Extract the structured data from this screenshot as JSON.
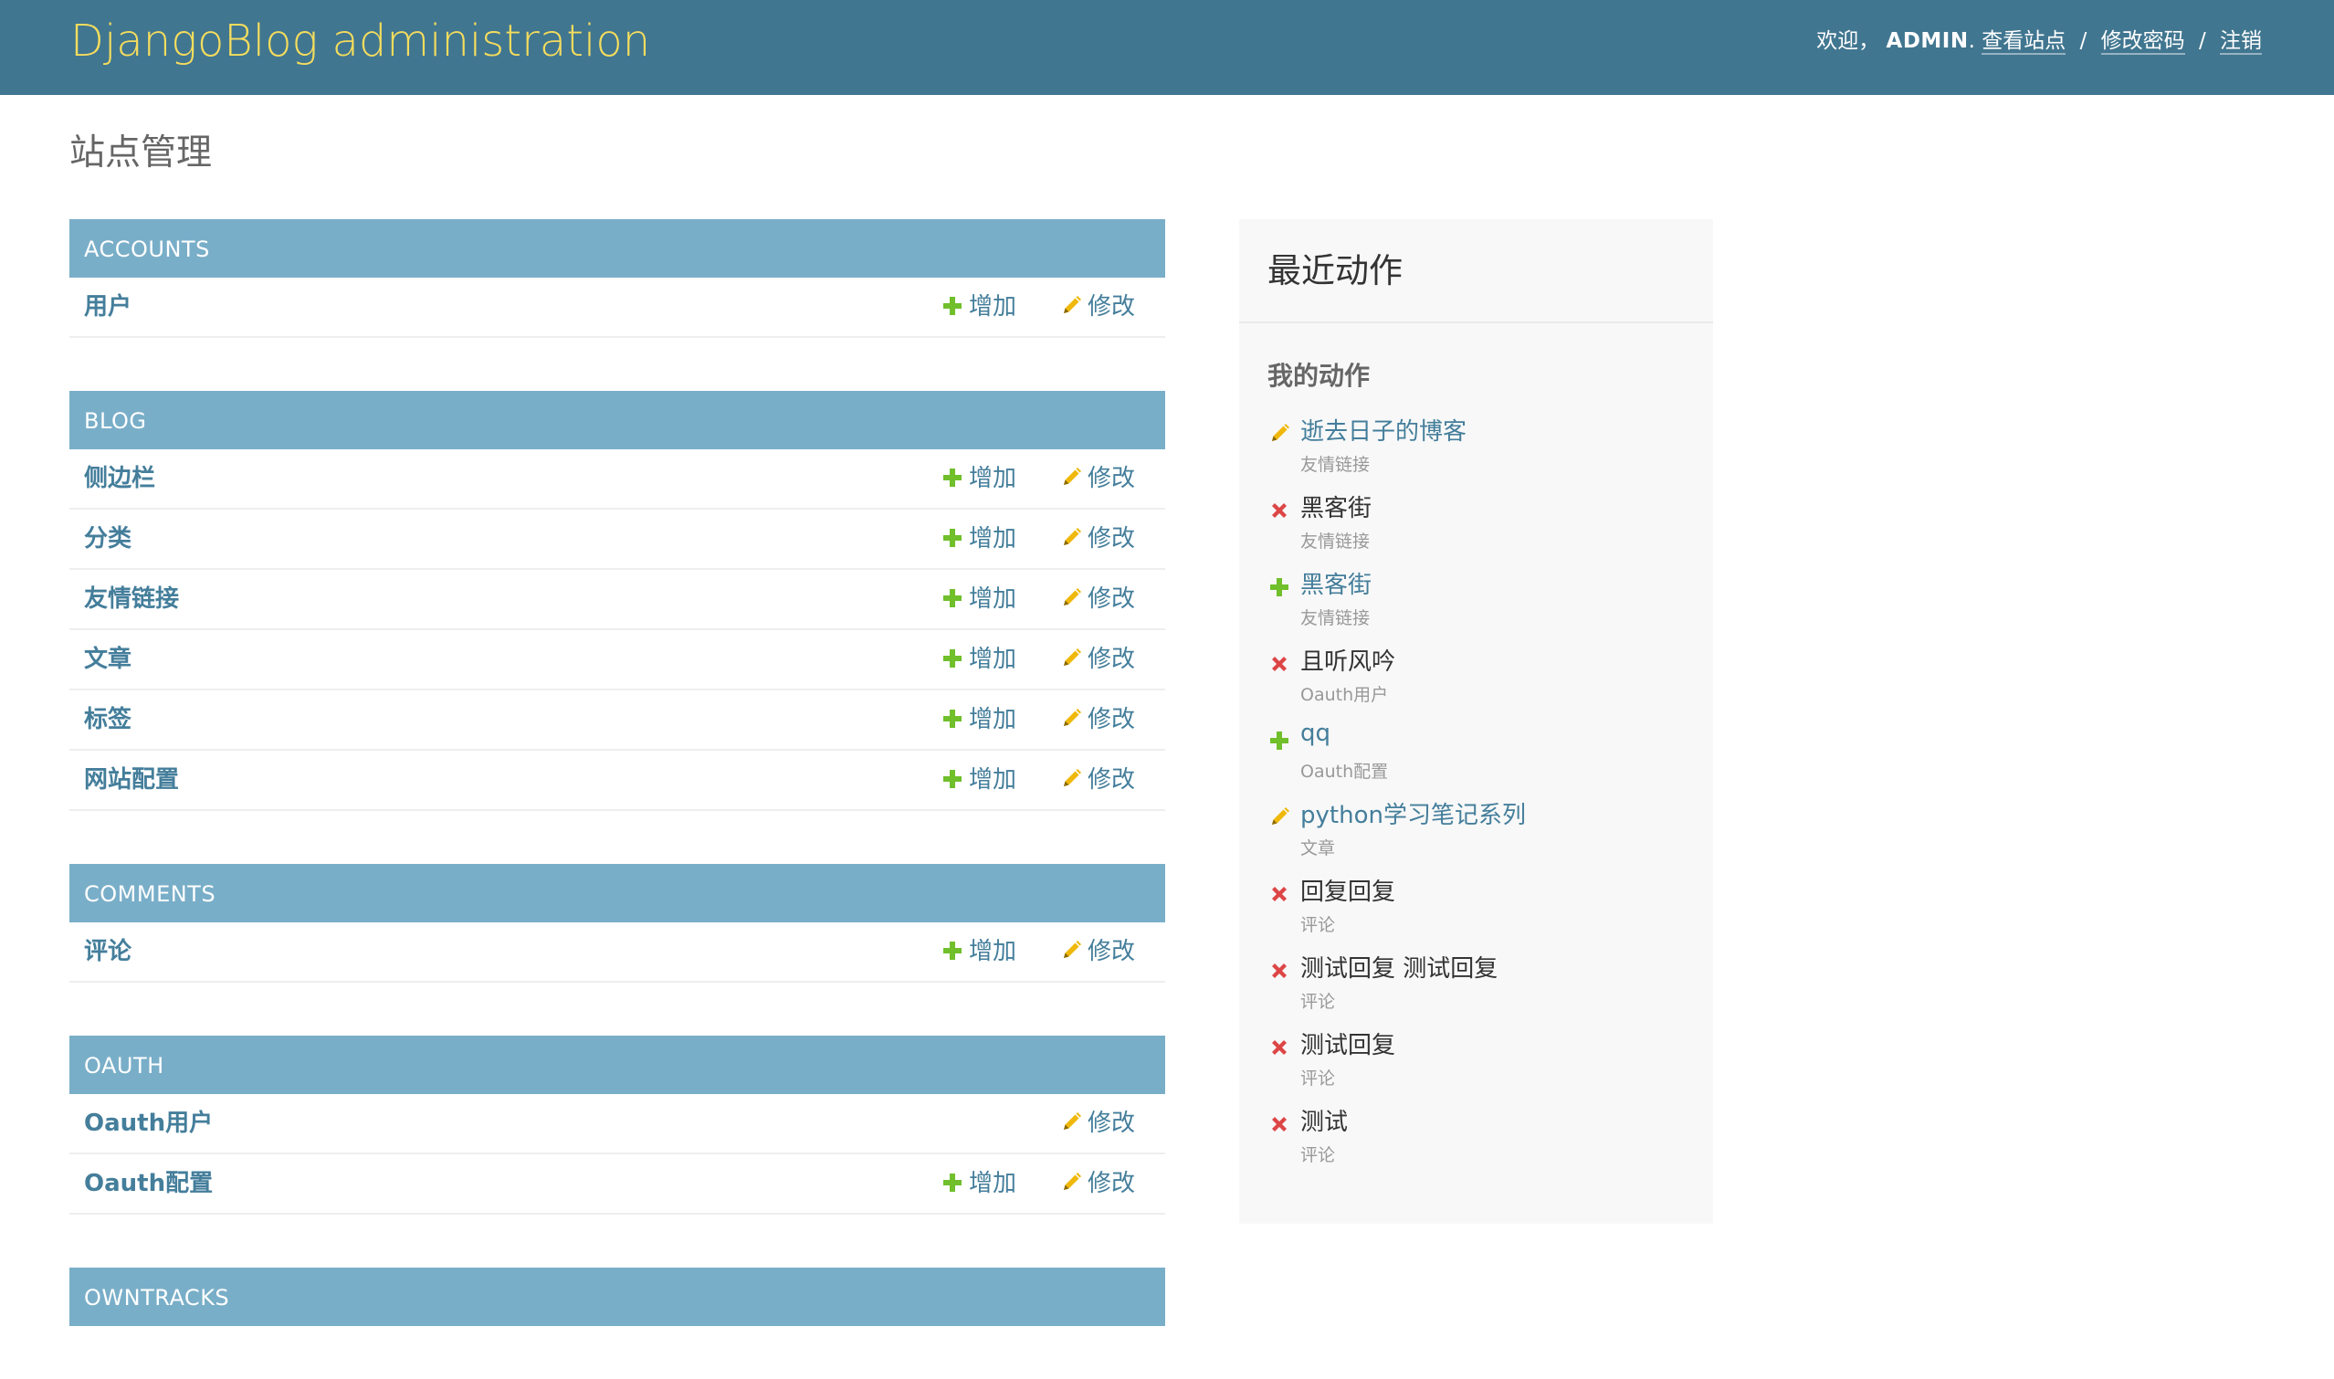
{
  "header": {
    "site_name": "DjangoBlog administration",
    "welcome": "欢迎，",
    "username": "ADMIN",
    "view_site": "查看站点",
    "change_password": "修改密码",
    "logout": "注销",
    "separator": "/"
  },
  "page": {
    "title": "站点管理"
  },
  "labels": {
    "add": "增加",
    "change": "修改"
  },
  "colors": {
    "header_bg": "#417690",
    "site_name": "#f5dd5d",
    "module_caption_bg": "#79aec8",
    "link": "#447e9b",
    "add_icon": "#70bf2b",
    "change_icon": "#efb80b",
    "delete_icon": "#dd4646"
  },
  "icons": {
    "add": "plus-icon",
    "change": "pencil-icon",
    "delete": "cross-icon"
  },
  "apps": [
    {
      "caption": "ACCOUNTS",
      "models": [
        {
          "name": "用户"
        }
      ]
    },
    {
      "caption": "BLOG",
      "models": [
        {
          "name": "侧边栏"
        },
        {
          "name": "分类"
        },
        {
          "name": "友情链接"
        },
        {
          "name": "文章"
        },
        {
          "name": "标签"
        },
        {
          "name": "网站配置"
        }
      ]
    },
    {
      "caption": "COMMENTS",
      "models": [
        {
          "name": "评论"
        }
      ]
    },
    {
      "caption": "OAUTH",
      "models": [
        {
          "name": "Oauth用户"
        },
        {
          "name": "Oauth配置"
        }
      ]
    },
    {
      "caption": "OWNTRACKS",
      "models": []
    }
  ],
  "recent_actions": {
    "title": "最近动作",
    "subtitle": "我的动作",
    "items": [
      {
        "object": "逝去日子的博客",
        "content_type": "友情链接",
        "action": "change"
      },
      {
        "object": "黑客街",
        "content_type": "友情链接",
        "action": "delete"
      },
      {
        "object": "黑客街",
        "content_type": "友情链接",
        "action": "add"
      },
      {
        "object": "且听风吟",
        "content_type": "Oauth用户",
        "action": "delete"
      },
      {
        "object": "qq",
        "content_type": "Oauth配置",
        "action": "add"
      },
      {
        "object": "python学习笔记系列",
        "content_type": "文章",
        "action": "change"
      },
      {
        "object": "回复回复",
        "content_type": "评论",
        "action": "delete"
      },
      {
        "object": "测试回复 测试回复",
        "content_type": "评论",
        "action": "delete"
      },
      {
        "object": "测试回复",
        "content_type": "评论",
        "action": "delete"
      },
      {
        "object": "测试",
        "content_type": "评论",
        "action": "delete"
      }
    ]
  }
}
